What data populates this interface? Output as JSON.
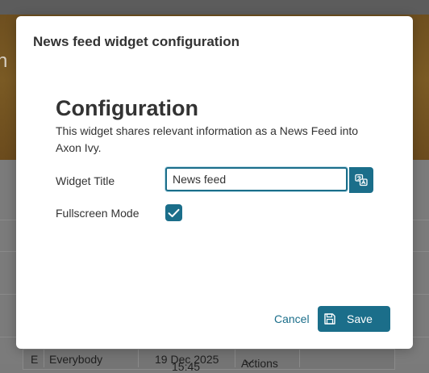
{
  "background": {
    "banner_text": "n",
    "row": {
      "initial": "E",
      "audience": "Everybody",
      "date": "19 Dec 2025",
      "time": "15:45",
      "actions_label": "Actions"
    }
  },
  "dialog": {
    "title": "News feed widget configuration",
    "heading": "Configuration",
    "description": "This widget shares relevant information as a News Feed into Axon Ivy.",
    "widget_title": {
      "label": "Widget Title",
      "value": "News feed",
      "translate_icon": "translate-icon"
    },
    "fullscreen": {
      "label": "Fullscreen Mode",
      "checked": true
    },
    "cancel_label": "Cancel",
    "save_label": "Save",
    "save_icon": "save-icon"
  },
  "colors": {
    "primary": "#1b6e8a",
    "text": "#333333",
    "overlay": "#7a7a7a"
  }
}
